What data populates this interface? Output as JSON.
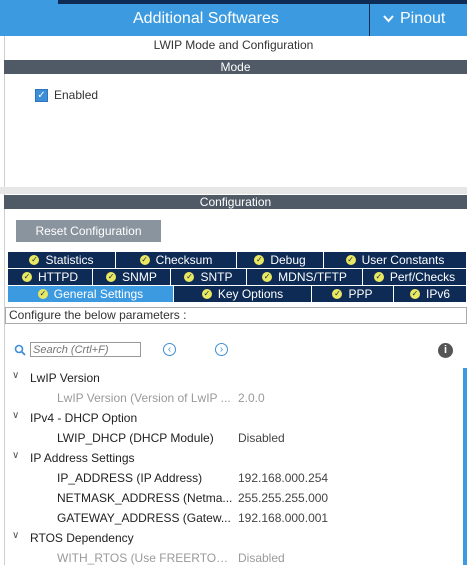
{
  "header": {
    "title": "Additional Softwares",
    "pinout_label": "Pinout"
  },
  "panel": {
    "subtitle": "LWIP Mode and Configuration"
  },
  "mode": {
    "section_label": "Mode",
    "enabled_label": "Enabled",
    "enabled_checked": true
  },
  "configuration": {
    "section_label": "Configuration",
    "reset_label": "Reset Configuration",
    "tabs_row1": [
      "Statistics",
      "Checksum",
      "Debug",
      "User Constants"
    ],
    "tabs_row2": [
      "HTTPD",
      "SNMP",
      "SNTP",
      "MDNS/TFTP",
      "Perf/Checks"
    ],
    "tabs_row3": [
      "General Settings",
      "Key Options",
      "PPP",
      "IPv6"
    ],
    "active_tab": "General Settings",
    "params_header": "Configure the below parameters :",
    "search_placeholder": "Search (Crtl+F)",
    "groups": [
      {
        "name": "LwIP Version",
        "params": [
          {
            "name": "LwIP Version (Version of LwIP ...",
            "value": "2.0.0",
            "disabled": true
          }
        ]
      },
      {
        "name": "IPv4 - DHCP Option",
        "params": [
          {
            "name": "LWIP_DHCP (DHCP Module)",
            "value": "Disabled",
            "disabled": false
          }
        ]
      },
      {
        "name": "IP Address Settings",
        "params": [
          {
            "name": "IP_ADDRESS (IP Address)",
            "value": "192.168.000.254",
            "disabled": false
          },
          {
            "name": "NETMASK_ADDRESS (Netma...",
            "value": "255.255.255.000",
            "disabled": false
          },
          {
            "name": "GATEWAY_ADDRESS (Gatew...",
            "value": "192.168.000.001",
            "disabled": false
          }
        ]
      },
      {
        "name": "RTOS Dependency",
        "params": [
          {
            "name": "WITH_RTOS (Use FREERTOS...",
            "value": "Disabled",
            "disabled": true
          }
        ]
      }
    ]
  },
  "colors": {
    "accent": "#3c9be0",
    "navy": "#0d2b55",
    "section_bar": "#505a66",
    "check_dot": "#e9e860"
  },
  "icons": {
    "search": "magnifier-icon",
    "prev": "chevron-left-circle-icon",
    "next": "chevron-right-circle-icon",
    "info": "info-icon",
    "tab_check": "check-circle-icon",
    "expand": "chevron-down-icon"
  }
}
